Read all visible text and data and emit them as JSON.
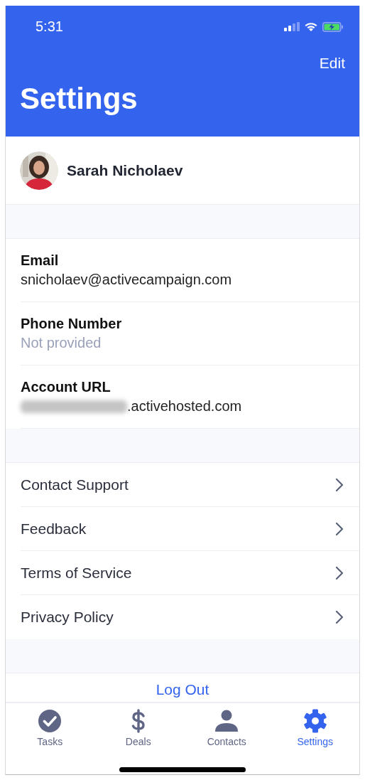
{
  "status_bar": {
    "time": "5:31"
  },
  "nav": {
    "action": "Edit",
    "title": "Settings"
  },
  "profile": {
    "name": "Sarah Nicholaev"
  },
  "fields": [
    {
      "label": "Email",
      "value": "snicholaev@activecampaign.com",
      "provided": true,
      "redacted": false
    },
    {
      "label": "Phone Number",
      "value": "Not provided",
      "provided": false,
      "redacted": false
    },
    {
      "label": "Account URL",
      "value": ".activehosted.com",
      "provided": true,
      "redacted": true
    }
  ],
  "links": [
    {
      "label": "Contact Support"
    },
    {
      "label": "Feedback"
    },
    {
      "label": "Terms of Service"
    },
    {
      "label": "Privacy Policy"
    }
  ],
  "logout": "Log Out",
  "tabs": [
    {
      "label": "Tasks",
      "kind": "check",
      "selected": false
    },
    {
      "label": "Deals",
      "kind": "dollar",
      "selected": false
    },
    {
      "label": "Contacts",
      "kind": "person",
      "selected": false
    },
    {
      "label": "Settings",
      "kind": "gear",
      "selected": true
    }
  ]
}
